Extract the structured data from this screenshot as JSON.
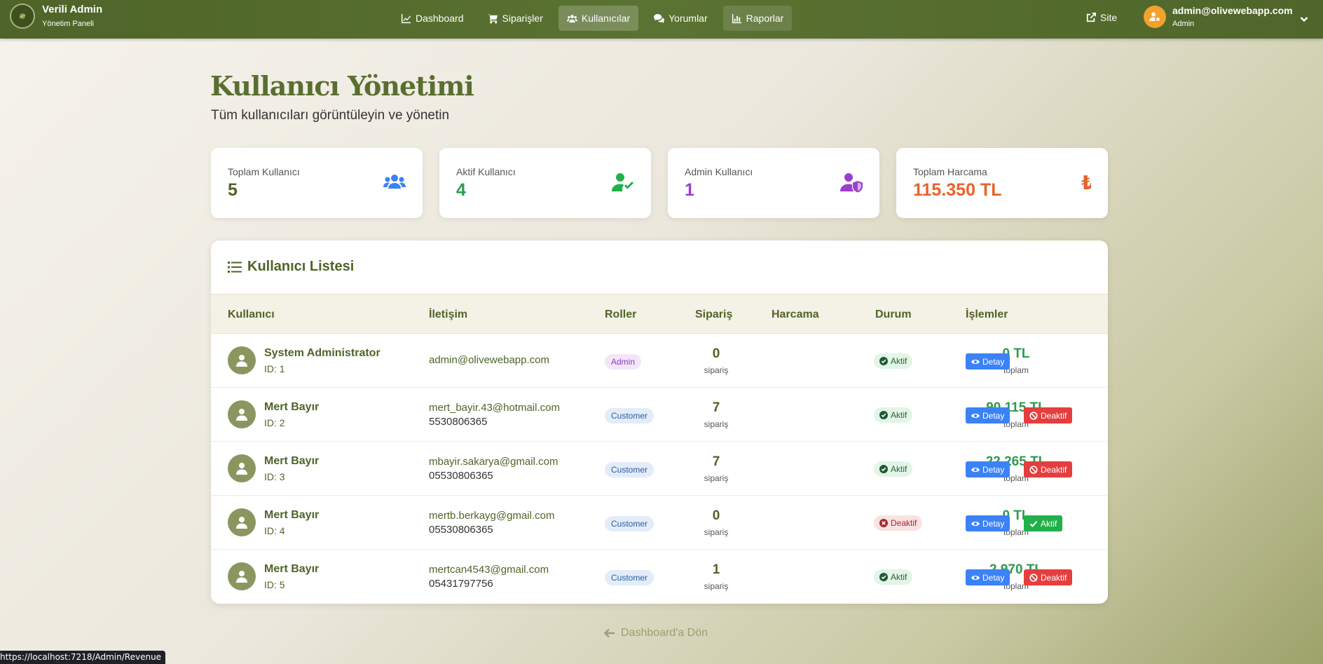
{
  "navbar": {
    "brand_title": "Verili Admin",
    "brand_sub": "Yönetim Paneli",
    "links": [
      {
        "label": "Dashboard",
        "icon": "chart-line-icon"
      },
      {
        "label": "Siparişler",
        "icon": "cart-icon"
      },
      {
        "label": "Kullanıcılar",
        "icon": "users-icon",
        "active": true
      },
      {
        "label": "Yorumlar",
        "icon": "comments-icon"
      },
      {
        "label": "Raporlar",
        "icon": "chart-bar-icon"
      }
    ],
    "site_label": "Site",
    "user_email": "admin@olivewebapp.com",
    "user_role": "Admin"
  },
  "page": {
    "title": "Kullanıcı Yönetimi",
    "subtitle": "Tüm kullanıcıları görüntüleyin ve yönetin"
  },
  "stats": [
    {
      "label": "Toplam Kullanıcı",
      "value": "5",
      "color": "#4e6428",
      "icon": "users-icon",
      "icon_color": "#3b82f6"
    },
    {
      "label": "Aktif Kullanıcı",
      "value": "4",
      "color": "#2e9a4e",
      "icon": "user-check-icon",
      "icon_color": "#22b04b"
    },
    {
      "label": "Admin Kullanıcı",
      "value": "1",
      "color": "#9b3fd0",
      "icon": "user-shield-icon",
      "icon_color": "#9b3fd0"
    },
    {
      "label": "Toplam Harcama",
      "value": "115.350 TL",
      "color": "#e8622a",
      "icon": "lira-icon",
      "icon_color": "#e8622a"
    }
  ],
  "table": {
    "title": "Kullanıcı Listesi",
    "headers": [
      "Kullanıcı",
      "İletişim",
      "Roller",
      "Sipariş",
      "Harcama",
      "Durum",
      "İşlemler"
    ],
    "orders_unit": "sipariş",
    "spend_unit": "toplam",
    "detail_label": "Detay",
    "rows": [
      {
        "name": "System Administrator",
        "id": "ID: 1",
        "email": "admin@olivewebapp.com",
        "phone": "",
        "role": "Admin",
        "orders": "0",
        "spend": "0 TL",
        "status": "Aktif",
        "action": ""
      },
      {
        "name": "Mert Bayır",
        "id": "ID: 2",
        "email": "mert_bayir.43@hotmail.com",
        "phone": "5530806365",
        "role": "Customer",
        "orders": "7",
        "spend": "90.115 TL",
        "status": "Aktif",
        "action": "Deaktif"
      },
      {
        "name": "Mert Bayır",
        "id": "ID: 3",
        "email": "mbayir.sakarya@gmail.com",
        "phone": "05530806365",
        "role": "Customer",
        "orders": "7",
        "spend": "22.265 TL",
        "status": "Aktif",
        "action": "Deaktif"
      },
      {
        "name": "Mert Bayır",
        "id": "ID: 4",
        "email": "mertb.berkayg@gmail.com",
        "phone": "05530806365",
        "role": "Customer",
        "orders": "0",
        "spend": "0 TL",
        "status": "Deaktif",
        "action": "Aktif"
      },
      {
        "name": "Mert Bayır",
        "id": "ID: 5",
        "email": "mertcan4543@gmail.com",
        "phone": "05431797756",
        "role": "Customer",
        "orders": "1",
        "spend": "2.970 TL",
        "status": "Aktif",
        "action": "Deaktif"
      }
    ]
  },
  "back_link": "Dashboard'a Dön",
  "status_bar_url": "https://localhost:7218/Admin/Revenue"
}
